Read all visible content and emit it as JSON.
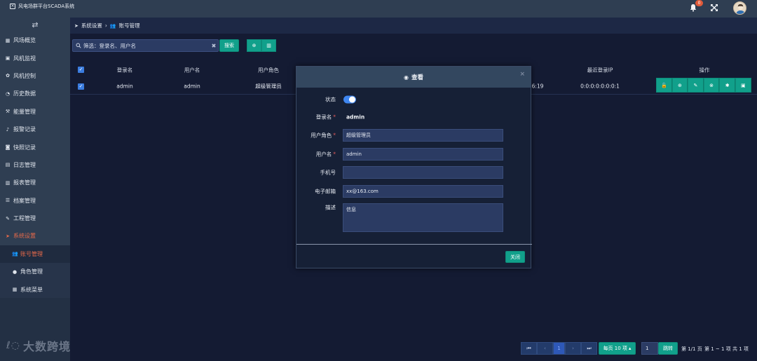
{
  "app": {
    "title": "风电场群平台SCADA系统",
    "notification_count": "0"
  },
  "sidebar": {
    "items": [
      {
        "label": "风场概览",
        "icon": "grid-icon"
      },
      {
        "label": "风机监视",
        "icon": "monitor-icon"
      },
      {
        "label": "风机控制",
        "icon": "gear-icon"
      },
      {
        "label": "历史数据",
        "icon": "pie-chart-icon"
      },
      {
        "label": "能量管理",
        "icon": "wrench-cross-icon"
      },
      {
        "label": "报警记录",
        "icon": "bell-icon"
      },
      {
        "label": "快照记录",
        "icon": "camera-icon"
      },
      {
        "label": "日志管理",
        "icon": "file-icon"
      },
      {
        "label": "报表管理",
        "icon": "table-icon"
      },
      {
        "label": "档案管理",
        "icon": "list-icon"
      },
      {
        "label": "工程管理",
        "icon": "wrench-icon"
      },
      {
        "label": "系统设置",
        "icon": "paper-plane-icon"
      }
    ],
    "subitems": [
      {
        "label": "账号管理",
        "icon": "users-icon"
      },
      {
        "label": "角色管理",
        "icon": "user-icon"
      },
      {
        "label": "系统菜单",
        "icon": "windows-icon"
      }
    ]
  },
  "breadcrumb": {
    "parent": "系统设置",
    "separator": "›",
    "current": "账号管理"
  },
  "search": {
    "placeholder": "筛选：登录名、用户名",
    "button_label": "搜索"
  },
  "table": {
    "columns": [
      "登录名",
      "用户名",
      "用户角色",
      "最近登录IP",
      "操作"
    ],
    "rows": [
      {
        "login": "admin",
        "username": "admin",
        "role": "超级管理员",
        "time_tail": "6:19",
        "ip": "0:0:0:0:0:0:0:1"
      }
    ],
    "row_actions": [
      "unlock-icon",
      "zoom-in-icon",
      "edit-icon",
      "close-circle-icon",
      "asterisk-icon",
      "image-icon"
    ]
  },
  "modal": {
    "title": "查看",
    "fields": {
      "status_label": "状态",
      "login_label": "登录名",
      "login_value": "admin",
      "role_label": "用户角色",
      "role_value": "超级管理员",
      "username_label": "用户名",
      "username_value": "admin",
      "phone_label": "手机号",
      "phone_value": "",
      "email_label": "电子邮箱",
      "email_value": "xx@163.com",
      "desc_label": "描述",
      "desc_value": "信息"
    },
    "close_label": "关闭",
    "status_on": true
  },
  "pagination": {
    "current_page": "1",
    "page_size_label": "每页 10 项",
    "jump_value": "1",
    "jump_label": "跳转",
    "page_info": "第 1/1 页",
    "range_info": "第 1 ~ 1 项",
    "total_info": "共 1 项"
  },
  "watermark": {
    "text": "大数跨境"
  },
  "colors": {
    "accent": "#11a08b",
    "active_nav": "#e86a4a",
    "sidebar": "#2f3e52",
    "background": "#141b33"
  }
}
